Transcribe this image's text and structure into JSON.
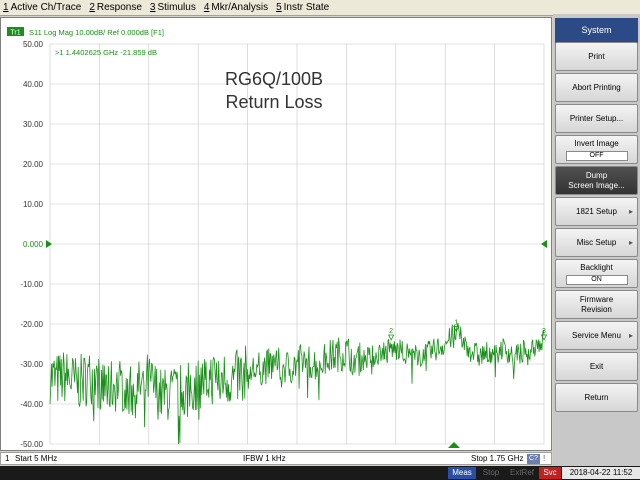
{
  "menu": [
    {
      "key": "1",
      "label": "Active Ch/Trace"
    },
    {
      "key": "2",
      "label": "Response"
    },
    {
      "key": "3",
      "label": "Stimulus"
    },
    {
      "key": "4",
      "label": "Mkr/Analysis"
    },
    {
      "key": "5",
      "label": "Instr State"
    }
  ],
  "trace": {
    "badge": "Tr1",
    "header": "S11 Log Mag 10.00dB/ Ref 0.000dB [F1]",
    "marker_readout": ">1  1.4402625 GHz -21.859 dB",
    "title_line1": "RG6Q/100B",
    "title_line2": "Return Loss",
    "marker_labels": [
      "1",
      "2",
      "3"
    ],
    "color": "#1a8f1a"
  },
  "chart_data": {
    "type": "line",
    "title": "RG6Q/100B Return Loss",
    "xlabel": "",
    "ylabel": "",
    "x_start_mhz": 5,
    "x_stop_mhz": 1750,
    "ylim": [
      -50,
      50
    ],
    "y_ticks": [
      "50.00",
      "40.00",
      "30.00",
      "20.00",
      "10.00",
      "0.000",
      "-10.00",
      "-20.00",
      "-30.00",
      "-40.00",
      "-50.00"
    ],
    "grid": true,
    "series": [
      {
        "x_mhz": [
          5,
          30,
          60,
          100,
          150,
          200,
          250,
          300,
          350,
          400,
          450,
          500,
          550,
          600,
          650,
          700,
          750,
          800,
          850,
          900,
          950,
          1000,
          1050,
          1100,
          1150,
          1200,
          1250,
          1300,
          1350,
          1400,
          1440,
          1480,
          1520,
          1560,
          1600,
          1650,
          1700,
          1750
        ],
        "values_db": [
          -33,
          -34,
          -33,
          -35,
          -33,
          -36,
          -35,
          -37,
          -34,
          -38,
          -37,
          -36,
          -34,
          -33,
          -34,
          -32,
          -31,
          -30,
          -31,
          -29,
          -30,
          -28,
          -27,
          -29,
          -28,
          -26,
          -27,
          -28,
          -27,
          -25,
          -22,
          -26,
          -28,
          -27,
          -26,
          -28,
          -26,
          -24
        ]
      }
    ],
    "markers": [
      {
        "id": "1",
        "x_mhz": 1440.2625,
        "value_db": -21.859
      },
      {
        "id": "2",
        "x_mhz": 1210,
        "value_db": -24
      },
      {
        "id": "3",
        "x_mhz": 1750,
        "value_db": -24
      }
    ]
  },
  "status": {
    "channel": "1",
    "start": "Start 5 MHz",
    "ifbw": "IFBW 1 kHz",
    "stop": "Stop 1.75 GHz",
    "badge": "C?",
    "indicator": "!"
  },
  "bottom": {
    "meas": "Meas",
    "stop": "Stop",
    "extref": "ExtRef",
    "svc": "Svc",
    "datetime": "2018-04-22 11:52"
  },
  "panel": {
    "title": "System",
    "print": "Print",
    "abort": "Abort Printing",
    "printer_setup": "Printer Setup...",
    "invert_label": "Invert Image",
    "invert_value": "OFF",
    "dump_line1": "Dump",
    "dump_line2": "Screen Image...",
    "setup_1821": "1821 Setup",
    "misc_setup": "Misc Setup",
    "backlight_label": "Backlight",
    "backlight_value": "ON",
    "firmware_line1": "Firmware",
    "firmware_line2": "Revision",
    "service_menu": "Service Menu",
    "exit": "Exit",
    "return": "Return"
  }
}
